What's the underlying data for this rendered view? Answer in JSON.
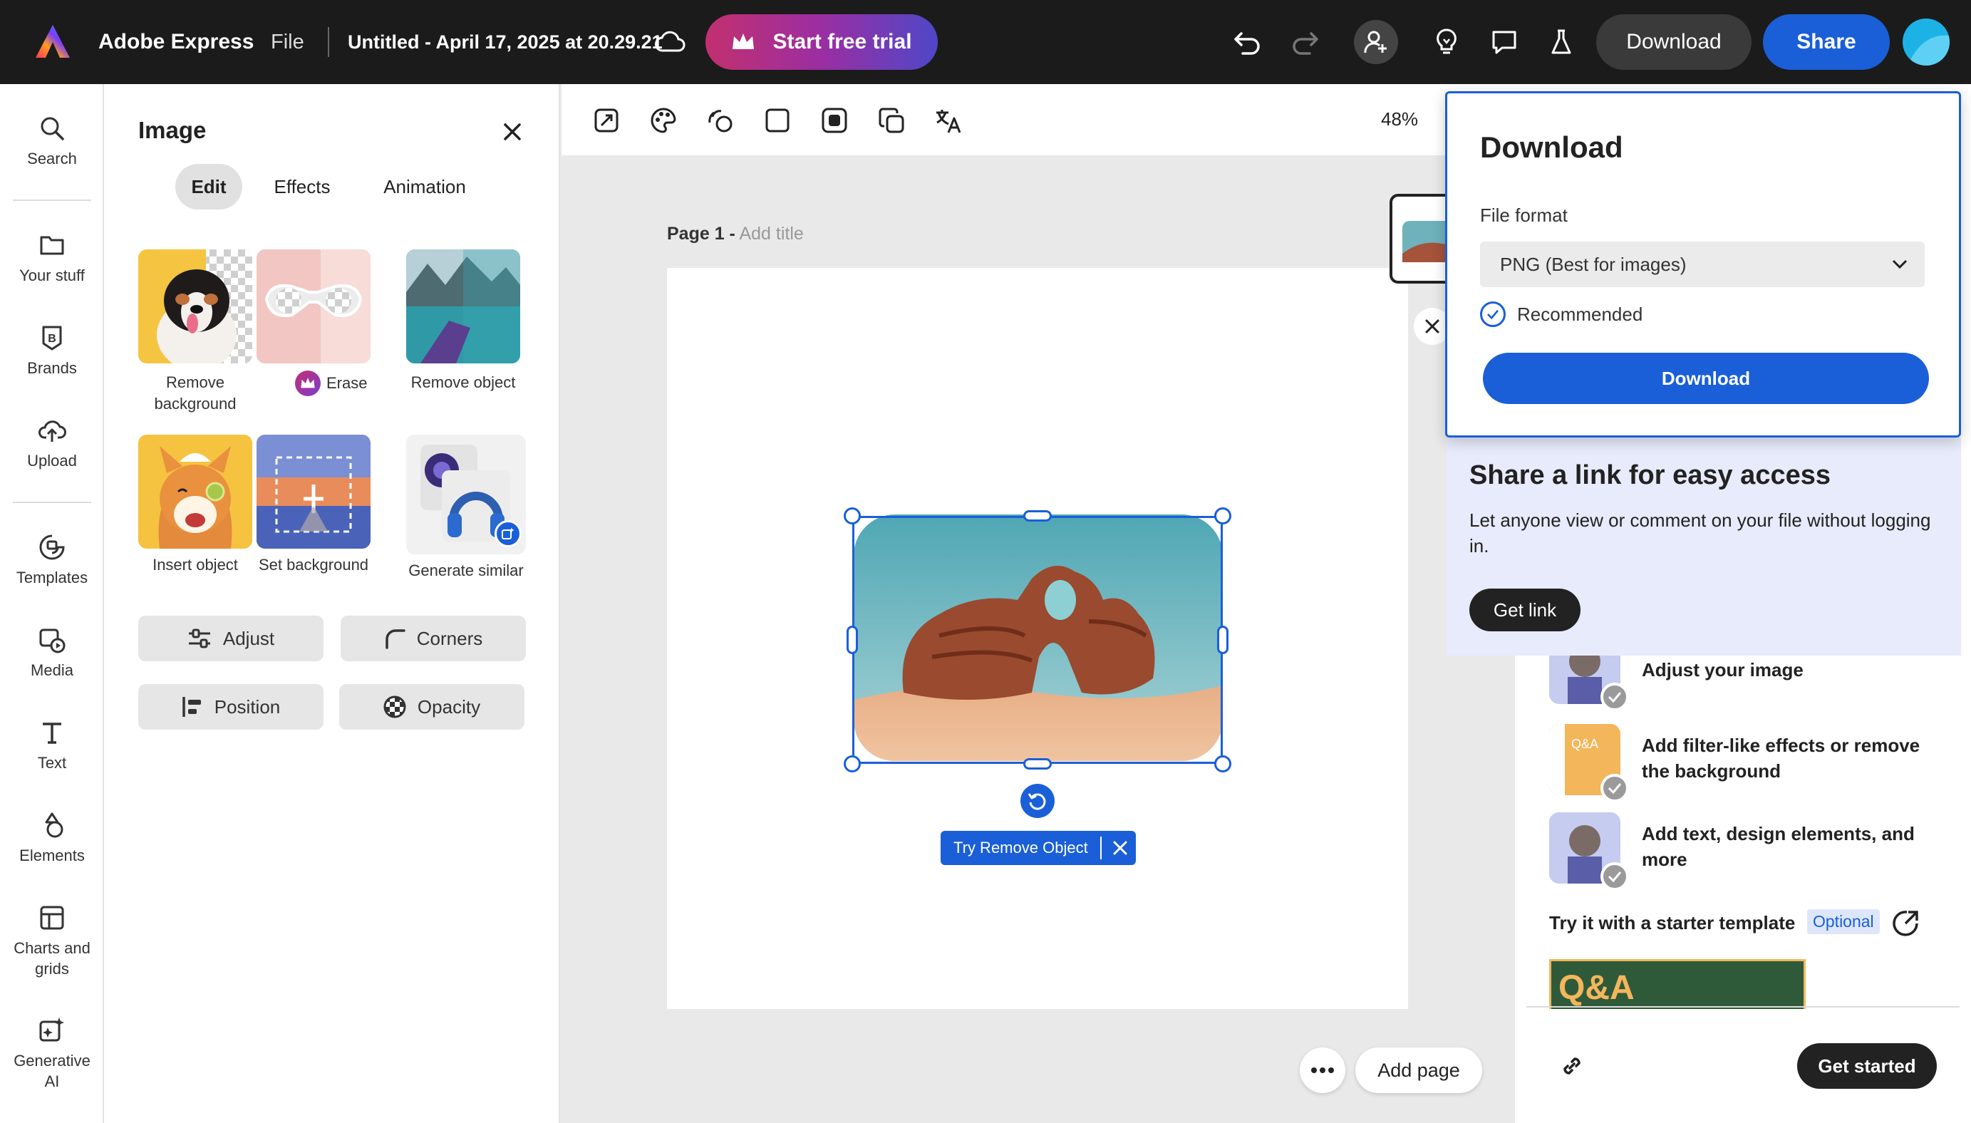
{
  "topbar": {
    "app_name": "Adobe Express",
    "file_menu": "File",
    "doc_title": "Untitled - April 17, 2025 at 20.29.21",
    "trial_button": "Start free trial",
    "download_button": "Download",
    "share_button": "Share",
    "trial_gradient": [
      "#b62b6e",
      "#3d48c7"
    ],
    "share_color": "#1a5fd8"
  },
  "rail": {
    "items": [
      {
        "label": "Search",
        "icon": "search-icon"
      },
      {
        "label": "Your stuff",
        "icon": "folder-icon"
      },
      {
        "label": "Brands",
        "icon": "brand-icon"
      },
      {
        "label": "Upload",
        "icon": "cloud-upload-icon"
      },
      {
        "label": "Templates",
        "icon": "templates-icon"
      },
      {
        "label": "Media",
        "icon": "media-icon"
      },
      {
        "label": "Text",
        "icon": "text-icon"
      },
      {
        "label": "Elements",
        "icon": "elements-icon"
      },
      {
        "label": "Charts and grids",
        "icon": "grid-icon"
      },
      {
        "label": "Generative AI",
        "icon": "sparkle-icon"
      }
    ]
  },
  "panel": {
    "title": "Image",
    "tabs": [
      "Edit",
      "Effects",
      "Animation"
    ],
    "tiles": [
      {
        "label": "Remove background"
      },
      {
        "label": "Erase"
      },
      {
        "label": "Remove object"
      },
      {
        "label": "Insert object"
      },
      {
        "label": "Set background"
      },
      {
        "label": "Generate similar"
      }
    ],
    "buttons": [
      "Adjust",
      "Corners",
      "Position",
      "Opacity"
    ]
  },
  "canvas": {
    "zoom": "48%",
    "page_label": "Page 1 -",
    "page_title_placeholder": "Add title",
    "try_remove_object": "Try Remove Object",
    "add_page": "Add page"
  },
  "download_popover": {
    "title": "Download",
    "format_label": "File format",
    "format_value": "PNG (Best for images)",
    "recommended": "Recommended",
    "button": "Download"
  },
  "share_popover": {
    "title": "Share a link for easy access",
    "body": "Let anyone view or comment on your file without logging in.",
    "button": "Get link"
  },
  "onboarding": {
    "steps": [
      "Adjust your image",
      "Add filter-like effects or remove the background",
      "Add text, design elements, and more"
    ],
    "template_prompt": "Try it with a starter template",
    "optional_badge": "Optional",
    "template_thumb_text": "Q&A",
    "get_started": "Get started"
  }
}
